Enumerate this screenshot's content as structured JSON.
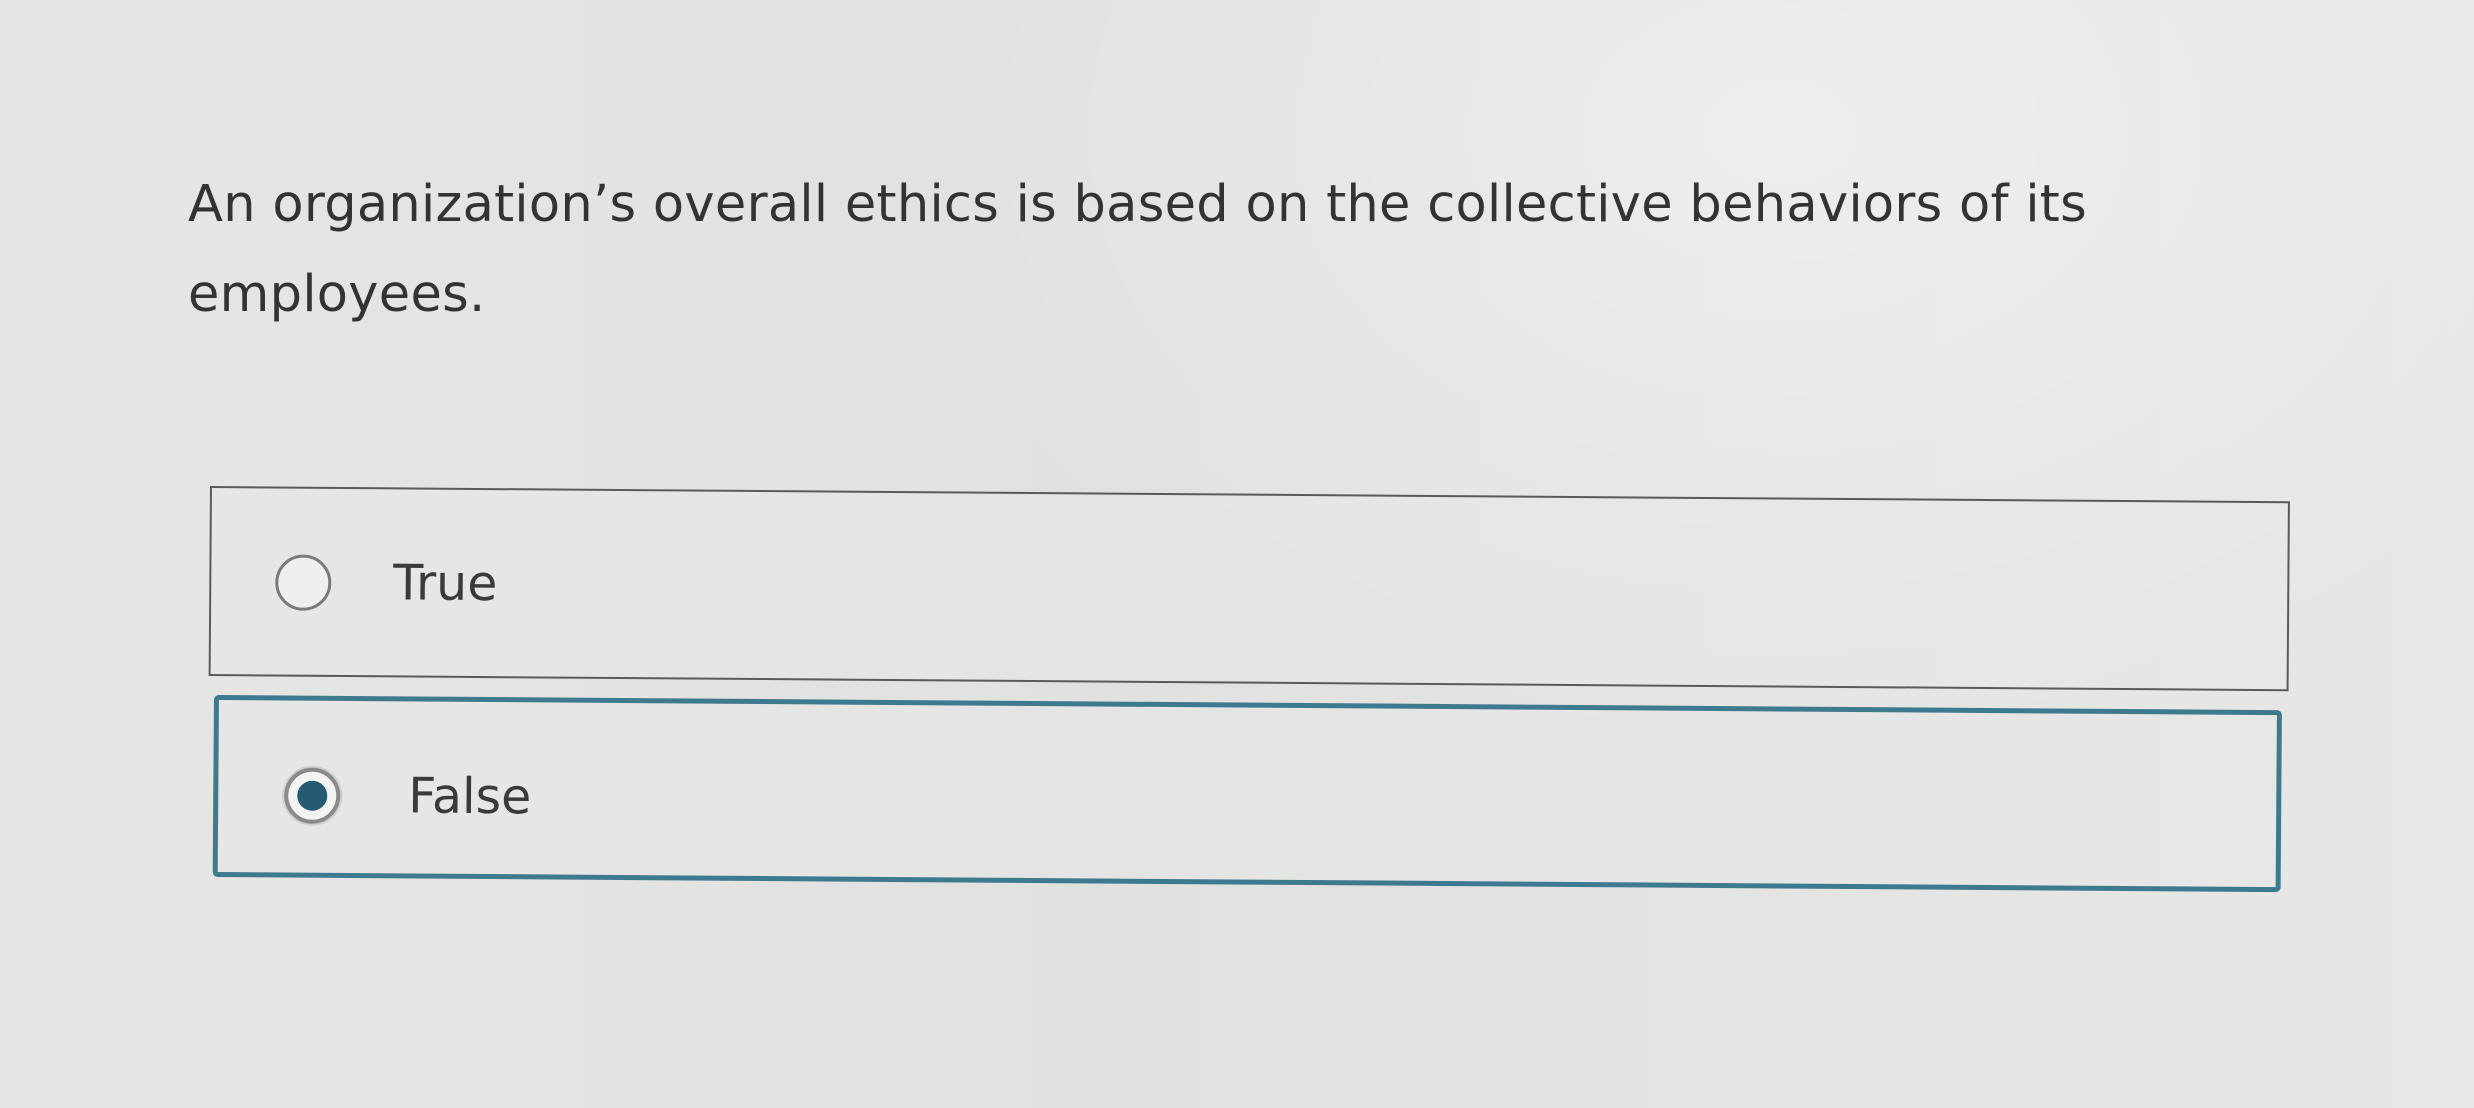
{
  "question": {
    "text": "An organization’s overall ethics is based on the collective behaviors of its employees."
  },
  "options": [
    {
      "label": "True",
      "selected": false
    },
    {
      "label": "False",
      "selected": true
    }
  ],
  "colors": {
    "selected_border": "#3d7a8f",
    "selected_dot": "#245b72",
    "unselected_border": "#5a5a5a"
  },
  "icons": {
    "radio_unselected": "radio-unchecked-icon",
    "radio_selected": "radio-checked-icon"
  }
}
